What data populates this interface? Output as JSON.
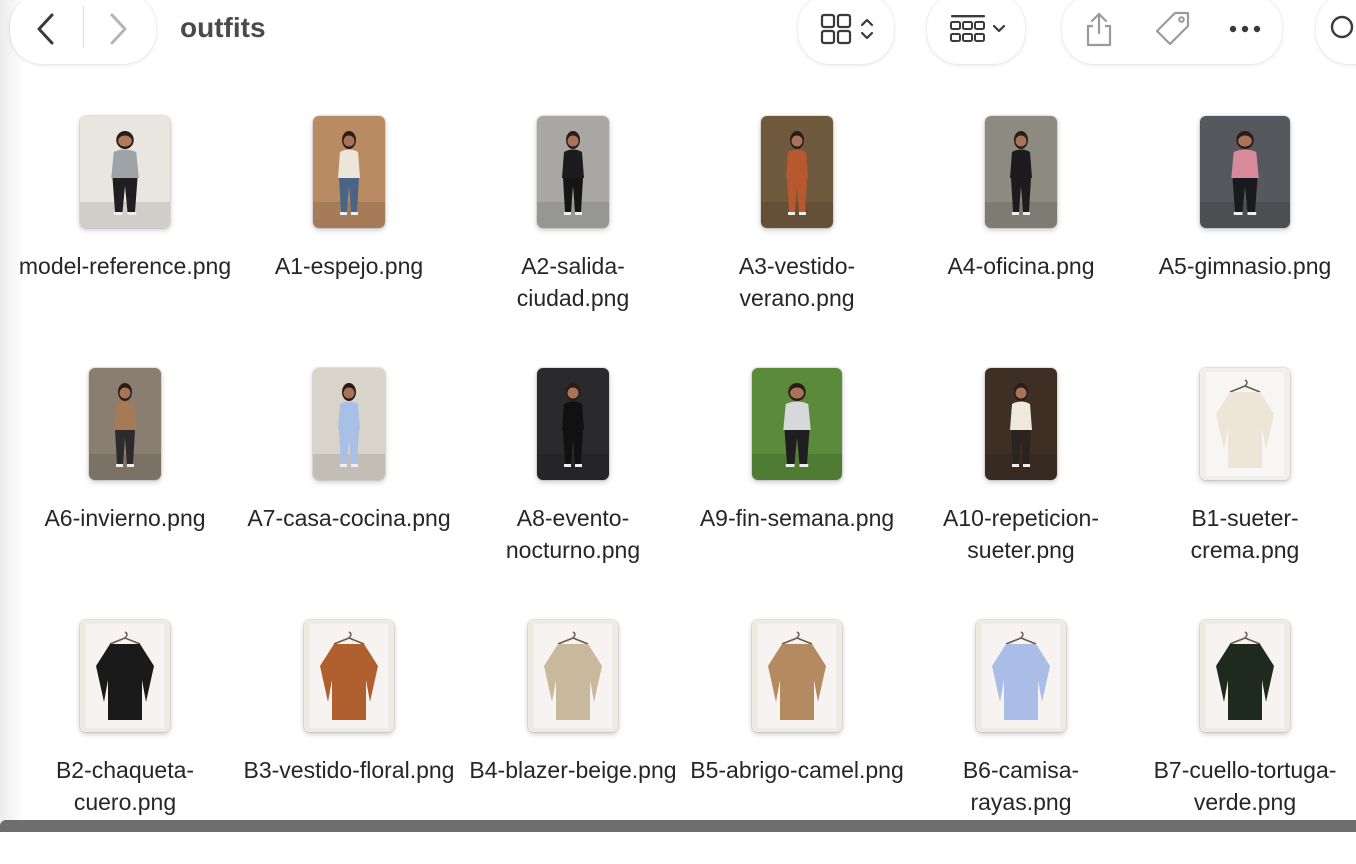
{
  "window": {
    "title": "outfits"
  },
  "toolbar": {
    "back_icon": "chevron-left-icon",
    "forward_icon": "chevron-right-icon",
    "view_icon": "grid-view-icon",
    "group_icon": "group-by-icon",
    "share_icon": "share-icon",
    "tag_icon": "tag-icon",
    "more_icon": "ellipsis-icon",
    "search_icon": "search-icon"
  },
  "files": [
    {
      "name": "model-reference.png",
      "kind": "person",
      "bg": "#e9e6e0",
      "top": "#9ea3a8",
      "bottom": "#1f1f22",
      "skin": "#b07a5c",
      "shape": "portrait-wide"
    },
    {
      "name": "A1-espejo.png",
      "kind": "person",
      "bg": "#b98b62",
      "top": "#ece6d9",
      "bottom": "#4a6488",
      "skin": "#a9735a",
      "shape": "portrait"
    },
    {
      "name": "A2-salida-ciudad.png",
      "kind": "person",
      "bg": "#a8a7a4",
      "top": "#1c1c1e",
      "bottom": "#151515",
      "skin": "#a9735a",
      "shape": "portrait"
    },
    {
      "name": "A3-vestido-verano.png",
      "kind": "person",
      "bg": "#6f5a3e",
      "top": "#b8582e",
      "bottom": "#b8582e",
      "skin": "#a9735a",
      "shape": "portrait"
    },
    {
      "name": "A4-oficina.png",
      "kind": "person",
      "bg": "#8d8a80",
      "top": "#1c1c1e",
      "bottom": "#1c1c1e",
      "skin": "#a9735a",
      "shape": "portrait"
    },
    {
      "name": "A5-gimnasio.png",
      "kind": "person",
      "bg": "#55585c",
      "top": "#d98a9a",
      "bottom": "#1a1a1c",
      "skin": "#a9735a",
      "shape": "portrait-wide"
    },
    {
      "name": "A6-invierno.png",
      "kind": "person",
      "bg": "#8a7e70",
      "top": "#a57a55",
      "bottom": "#2b2b2e",
      "skin": "#a9735a",
      "shape": "portrait"
    },
    {
      "name": "A7-casa-cocina.png",
      "kind": "person",
      "bg": "#d9d4ca",
      "top": "#a8c0e6",
      "bottom": "#a8c0e6",
      "skin": "#a9735a",
      "shape": "portrait"
    },
    {
      "name": "A8-evento-nocturno.png",
      "kind": "person",
      "bg": "#2a2a2c",
      "top": "#111111",
      "bottom": "#111111",
      "skin": "#a9735a",
      "shape": "portrait"
    },
    {
      "name": "A9-fin-semana.png",
      "kind": "person",
      "bg": "#5a8a3a",
      "top": "#d6d8dc",
      "bottom": "#1f1f22",
      "skin": "#a9735a",
      "shape": "portrait-wide"
    },
    {
      "name": "A10-repeticion-sueter.png",
      "kind": "person",
      "bg": "#3e2f25",
      "top": "#efe9dd",
      "bottom": "#2b2320",
      "skin": "#a9735a",
      "shape": "portrait"
    },
    {
      "name": "B1-sueter-crema.png",
      "kind": "garment",
      "bg": "#f1efeb",
      "top": "#ede6d6",
      "bottom": "#ede6d6",
      "skin": "#7a6a55",
      "shape": "portrait-wide"
    },
    {
      "name": "B2-chaqueta-cuero.png",
      "kind": "garment",
      "bg": "#eeeae4",
      "top": "#1a1a1a",
      "bottom": "#1a1a1a",
      "skin": "#7a6a55",
      "shape": "portrait-wide"
    },
    {
      "name": "B3-vestido-floral.png",
      "kind": "garment",
      "bg": "#eeeae4",
      "top": "#b0602e",
      "bottom": "#b0602e",
      "skin": "#7a6a55",
      "shape": "portrait-wide"
    },
    {
      "name": "B4-blazer-beige.png",
      "kind": "garment",
      "bg": "#eeeae4",
      "top": "#c8b89c",
      "bottom": "#c8b89c",
      "skin": "#7a6a55",
      "shape": "portrait-wide"
    },
    {
      "name": "B5-abrigo-camel.png",
      "kind": "garment",
      "bg": "#eeeae4",
      "top": "#b48a60",
      "bottom": "#b48a60",
      "skin": "#7a6a55",
      "shape": "portrait-wide"
    },
    {
      "name": "B6-camisa-rayas.png",
      "kind": "garment",
      "bg": "#eeeae4",
      "top": "#a9bde6",
      "bottom": "#a9bde6",
      "skin": "#7a6a55",
      "shape": "portrait-wide"
    },
    {
      "name": "B7-cuello-tortuga-verde.png",
      "kind": "garment",
      "bg": "#eeeae4",
      "top": "#1f2a1e",
      "bottom": "#1f2a1e",
      "skin": "#7a6a55",
      "shape": "portrait-wide"
    }
  ]
}
